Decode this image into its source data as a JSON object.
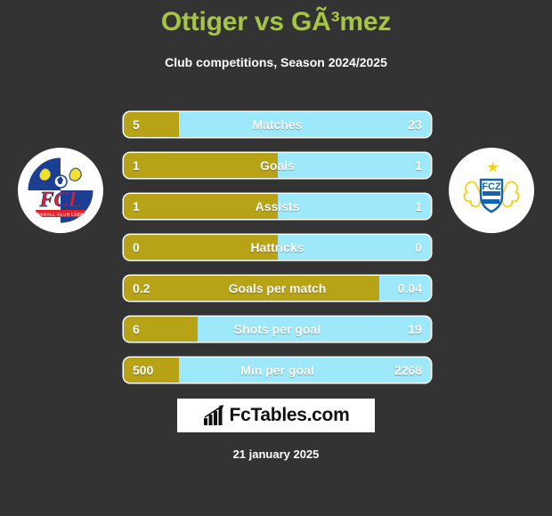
{
  "header": {
    "title": "Ottiger vs GÃ³mez",
    "subtitle": "Club competitions, Season 2024/2025"
  },
  "colors": {
    "background": "#333333",
    "title_green": "#a5c543",
    "home_bar_gold": "#b8a316",
    "away_bar_blue": "#9de9fb",
    "text_white": "#ffffff"
  },
  "crests": {
    "home": {
      "name": "fc-luzern-crest",
      "abbr": "FCL",
      "subtitle": "FUSSBALL CLUB LUZERN"
    },
    "away": {
      "name": "fc-zurich-crest",
      "abbr": "FCZ"
    }
  },
  "chart_data": {
    "type": "bar",
    "title": "Ottiger vs GÃ³mez",
    "subtitle": "Club competitions, Season 2024/2025",
    "orientation": "horizontal-diverging",
    "legend": [
      "Ottiger",
      "GÃ³mez"
    ],
    "categories": [
      "Matches",
      "Goals",
      "Assists",
      "Hattricks",
      "Goals per match",
      "Shots per goal",
      "Min per goal"
    ],
    "series": [
      {
        "name": "Ottiger",
        "color": "#b8a316",
        "values": [
          5,
          1,
          1,
          0,
          0.2,
          6,
          500
        ]
      },
      {
        "name": "GÃ³mez",
        "color": "#9de9fb",
        "values": [
          23,
          1,
          1,
          0,
          0.04,
          19,
          2268
        ]
      }
    ],
    "rows": [
      {
        "label": "Matches",
        "home": "5",
        "away": "23",
        "home_pct": 17.9
      },
      {
        "label": "Goals",
        "home": "1",
        "away": "1",
        "home_pct": 50.0
      },
      {
        "label": "Assists",
        "home": "1",
        "away": "1",
        "home_pct": 50.0
      },
      {
        "label": "Hattricks",
        "home": "0",
        "away": "0",
        "home_pct": 50.0
      },
      {
        "label": "Goals per match",
        "home": "0.2",
        "away": "0.04",
        "home_pct": 83.3
      },
      {
        "label": "Shots per goal",
        "home": "6",
        "away": "19",
        "home_pct": 24.0
      },
      {
        "label": "Min per goal",
        "home": "500",
        "away": "2268",
        "home_pct": 18.1
      }
    ]
  },
  "footer": {
    "brand": "FcTables.com",
    "brand_icon": "bar-chart-arrow-icon",
    "date": "21 january 2025"
  }
}
